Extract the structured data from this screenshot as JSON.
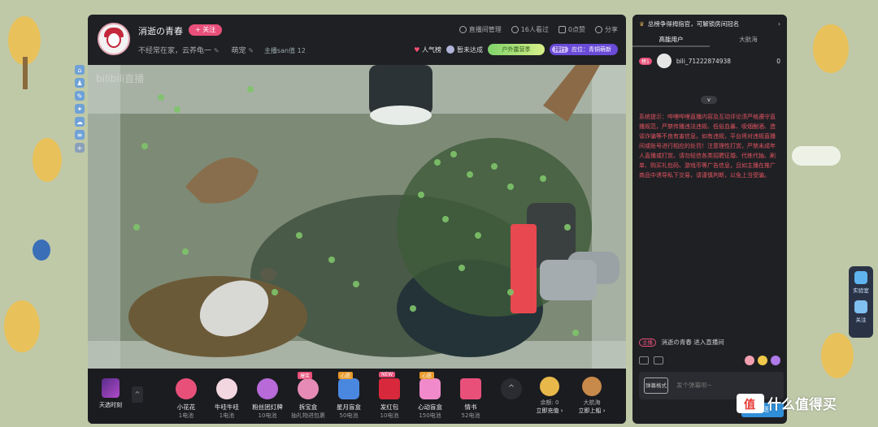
{
  "room": {
    "name": "消逝の青春",
    "follow_label": "+ 关注",
    "description": "不经常在家，云养龟一",
    "tag": "萌宠",
    "owner": "主播san值  12"
  },
  "header_actions": {
    "manage": "直播间管理",
    "viewers": "16人看过",
    "likes": "0点赞",
    "share": "分享"
  },
  "badges": {
    "popularity": "人气榜",
    "task": "暂未达成",
    "banner": "户外露营季",
    "rank": "应位：青铜萌新",
    "rank_prefix": "排行"
  },
  "video": {
    "watermark": "bilibili直播"
  },
  "gift_bar": {
    "daily_label": "天选时刻",
    "collapse": "^",
    "gifts": [
      {
        "name": "小花花",
        "price": "1电池",
        "tag": "",
        "color": "#e8507a"
      },
      {
        "name": "牛哇牛哇",
        "price": "1电池",
        "tag": "",
        "color": "#f2d7e0"
      },
      {
        "name": "粉丝团灯牌",
        "price": "10电池",
        "tag": "",
        "color": "#b86ad8"
      },
      {
        "name": "拆宝盒",
        "price": "抽礼物进包裹",
        "tag": "爆奖",
        "color": "#e58bb5"
      },
      {
        "name": "星月盲盒",
        "price": "50电池",
        "tag": "心愿",
        "color": "#4a88e0"
      },
      {
        "name": "发红包",
        "price": "10电池",
        "tag": "NEW",
        "color": "#d8283c"
      },
      {
        "name": "心动盲盒",
        "price": "150电池",
        "tag": "心愿",
        "color": "#f08acb"
      },
      {
        "name": "情书",
        "price": "52电池",
        "tag": "",
        "color": "#e8507a"
      }
    ],
    "more": "^",
    "balance_label": "余额: 0",
    "recharge": "立即充值 ›",
    "voyage_label": "大航海",
    "voyage_action": "立即上船 ›"
  },
  "chat": {
    "top_notice": "总榜争得拇指官，可解锁房间冠名",
    "arrow": "›",
    "tabs": [
      "高能用户",
      "大航海"
    ],
    "rank_entry": {
      "badge": "榜1",
      "name": "bili_71222874938",
      "value": "0"
    },
    "collapse": "v",
    "system_message": "系统提示：哔哩哔哩直播内容及互动评论须严格遵守直播规范，严禁传播违法违规、低俗血暴、吸烟酗酒、造谣诈骗等不良有害信息。如有违规，平台将对违规直播间或账号进行相应的处罚！注意理性打赏，严禁未成年人直播或打赏。请勿轻信各类招聘征婚、代练代抽、刷单、购买礼包码、游戏币等广告信息，且如主播在推广商品中诱导私下交易，请谨慎判断，以免上当受骗。",
    "enter_role": "主播",
    "enter_text": "消逝の青春  进入直播间",
    "danmaku_format": "弹幕格式",
    "danmaku_placeholder": "发个弹幕呗~",
    "send_label": "发送"
  },
  "float_right": {
    "lab": "实验室",
    "follow": "关注"
  },
  "watermark_logo": "什么值得买"
}
